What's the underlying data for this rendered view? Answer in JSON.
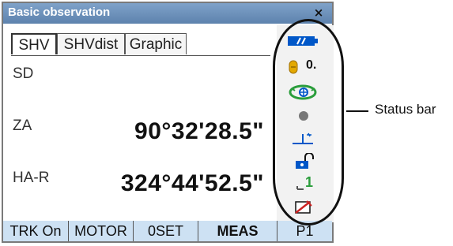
{
  "window": {
    "title": "Basic observation",
    "close_glyph": "×"
  },
  "tabs": [
    {
      "label": "SHV",
      "active": true
    },
    {
      "label": "SHVdist",
      "active": false
    },
    {
      "label": "Graphic",
      "active": false
    }
  ],
  "measurements": {
    "sd": {
      "label": "SD",
      "value": ""
    },
    "za": {
      "label": "ZA",
      "value": "90°32'28.5\""
    },
    "har": {
      "label": "HA-R",
      "value": "324°44'52.5\""
    }
  },
  "status_bar": {
    "tilt_value": "0.",
    "mode_number": "1",
    "icons": [
      "battery-icon",
      "target-icon",
      "tilt-icon",
      "laser-plummet-icon",
      "point-icon",
      "instrument-height-icon",
      "lock-icon",
      "mode-icon",
      "pen-icon"
    ],
    "colors": {
      "accent": "#0066cc",
      "green": "#2a9d3b",
      "orange": "#e38b00",
      "red": "#cc2222"
    }
  },
  "softkeys": [
    "TRK On",
    "MOTOR",
    "0SET",
    "MEAS",
    "P1"
  ],
  "callout": {
    "label": "Status bar"
  }
}
